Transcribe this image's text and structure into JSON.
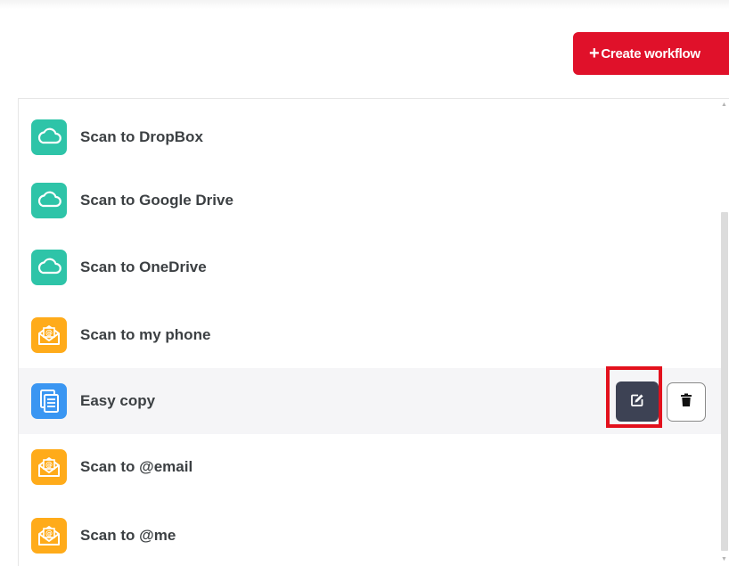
{
  "header": {
    "create_button_label": "Create workflow",
    "create_button_color": "#e0112a"
  },
  "workflows": [
    {
      "label": "Scan to DropBox",
      "icon": "cloud-icon",
      "color": "#2ec4a8"
    },
    {
      "label": "Scan to Google Drive",
      "icon": "cloud-icon",
      "color": "#2ec4a8"
    },
    {
      "label": "Scan to OneDrive",
      "icon": "cloud-icon",
      "color": "#2ec4a8"
    },
    {
      "label": "Scan to my phone",
      "icon": "email-envelope-icon",
      "color": "#ffab1a"
    },
    {
      "label": "Easy copy",
      "icon": "document-copy-icon",
      "color": "#3a96f2",
      "selected": true
    },
    {
      "label": "Scan to @email",
      "icon": "email-envelope-icon",
      "color": "#ffab1a"
    },
    {
      "label": "Scan to @me",
      "icon": "email-envelope-icon",
      "color": "#ffab1a"
    }
  ],
  "row_actions": {
    "edit_icon": "edit-icon",
    "delete_icon": "trash-icon"
  },
  "annotation": {
    "highlight_color": "#e3111d"
  }
}
